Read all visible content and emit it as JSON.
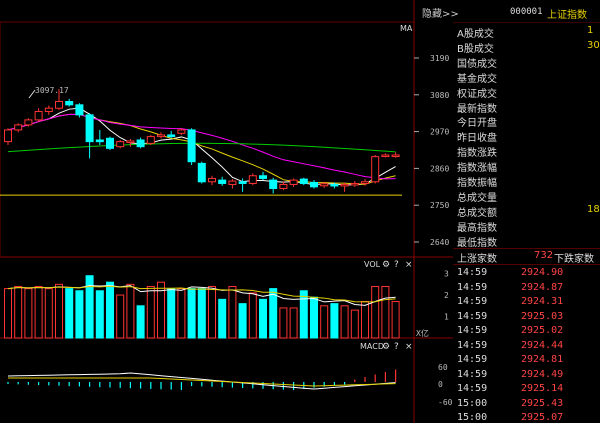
{
  "main": {
    "ma_label": "MA",
    "high_annotation": "3097.17",
    "yaxis": [
      "3190",
      "3080",
      "2970",
      "2860",
      "2750",
      "2640"
    ],
    "candles": [
      {
        "o": 2940,
        "c": 2975,
        "h": 2980,
        "l": 2930,
        "up": true
      },
      {
        "o": 2975,
        "c": 2990,
        "h": 2995,
        "l": 2968,
        "up": true
      },
      {
        "o": 2990,
        "c": 3005,
        "h": 3010,
        "l": 2985,
        "up": true
      },
      {
        "o": 3005,
        "c": 3030,
        "h": 3040,
        "l": 3000,
        "up": true
      },
      {
        "o": 3030,
        "c": 3040,
        "h": 3048,
        "l": 3020,
        "up": true
      },
      {
        "o": 3040,
        "c": 3060,
        "h": 3097,
        "l": 3035,
        "up": true
      },
      {
        "o": 3060,
        "c": 3050,
        "h": 3068,
        "l": 3045,
        "up": false
      },
      {
        "o": 3050,
        "c": 3020,
        "h": 3055,
        "l": 3012,
        "up": false
      },
      {
        "o": 3020,
        "c": 2940,
        "h": 3025,
        "l": 2890,
        "up": false
      },
      {
        "o": 2945,
        "c": 2940,
        "h": 2975,
        "l": 2930,
        "up": false
      },
      {
        "o": 2950,
        "c": 2920,
        "h": 2955,
        "l": 2915,
        "up": false
      },
      {
        "o": 2925,
        "c": 2940,
        "h": 2945,
        "l": 2920,
        "up": true
      },
      {
        "o": 2940,
        "c": 2942,
        "h": 2948,
        "l": 2925,
        "up": true
      },
      {
        "o": 2945,
        "c": 2925,
        "h": 2952,
        "l": 2920,
        "up": false
      },
      {
        "o": 2935,
        "c": 2955,
        "h": 2960,
        "l": 2930,
        "up": true
      },
      {
        "o": 2955,
        "c": 2960,
        "h": 2968,
        "l": 2950,
        "up": true
      },
      {
        "o": 2960,
        "c": 2955,
        "h": 2972,
        "l": 2950,
        "up": false
      },
      {
        "o": 2965,
        "c": 2975,
        "h": 2980,
        "l": 2960,
        "up": true
      },
      {
        "o": 2975,
        "c": 2880,
        "h": 2980,
        "l": 2870,
        "up": false
      },
      {
        "o": 2875,
        "c": 2820,
        "h": 2880,
        "l": 2815,
        "up": false
      },
      {
        "o": 2820,
        "c": 2830,
        "h": 2838,
        "l": 2810,
        "up": true
      },
      {
        "o": 2825,
        "c": 2815,
        "h": 2835,
        "l": 2808,
        "up": false
      },
      {
        "o": 2812,
        "c": 2822,
        "h": 2828,
        "l": 2800,
        "up": true
      },
      {
        "o": 2820,
        "c": 2815,
        "h": 2830,
        "l": 2790,
        "up": false
      },
      {
        "o": 2815,
        "c": 2838,
        "h": 2845,
        "l": 2810,
        "up": true
      },
      {
        "o": 2838,
        "c": 2830,
        "h": 2850,
        "l": 2825,
        "up": false
      },
      {
        "o": 2825,
        "c": 2800,
        "h": 2832,
        "l": 2785,
        "up": false
      },
      {
        "o": 2800,
        "c": 2812,
        "h": 2820,
        "l": 2795,
        "up": true
      },
      {
        "o": 2812,
        "c": 2825,
        "h": 2830,
        "l": 2805,
        "up": true
      },
      {
        "o": 2828,
        "c": 2815,
        "h": 2832,
        "l": 2810,
        "up": false
      },
      {
        "o": 2818,
        "c": 2805,
        "h": 2825,
        "l": 2800,
        "up": false
      },
      {
        "o": 2808,
        "c": 2814,
        "h": 2820,
        "l": 2802,
        "up": true
      },
      {
        "o": 2812,
        "c": 2808,
        "h": 2818,
        "l": 2800,
        "up": false
      },
      {
        "o": 2808,
        "c": 2812,
        "h": 2818,
        "l": 2790,
        "up": true
      },
      {
        "o": 2812,
        "c": 2815,
        "h": 2822,
        "l": 2805,
        "up": true
      },
      {
        "o": 2815,
        "c": 2820,
        "h": 2828,
        "l": 2808,
        "up": true
      },
      {
        "o": 2820,
        "c": 2895,
        "h": 2900,
        "l": 2815,
        "up": true
      },
      {
        "o": 2898,
        "c": 2900,
        "h": 2905,
        "l": 2893,
        "up": true
      },
      {
        "o": 2900,
        "c": 2897,
        "h": 2908,
        "l": 2892,
        "up": true
      }
    ]
  },
  "vol_panel": {
    "title": "VOL",
    "yaxis": [
      "3",
      "2",
      "1"
    ],
    "unit": "X亿",
    "bars": [
      2.3,
      2.4,
      2.3,
      2.4,
      2.3,
      2.5,
      2.3,
      2.2,
      2.9,
      2.2,
      2.6,
      2.0,
      2.5,
      1.5,
      2.4,
      2.6,
      2.3,
      2.3,
      2.3,
      2.3,
      2.4,
      1.8,
      2.4,
      1.6,
      2.1,
      1.8,
      2.3,
      1.4,
      1.4,
      2.2,
      1.9,
      1.5,
      1.6,
      1.5,
      1.3,
      1.7,
      2.4,
      2.4,
      1.7
    ]
  },
  "macd_panel": {
    "title": "MACD",
    "yaxis": [
      "60",
      "0",
      "-60"
    ]
  },
  "header": {
    "hide_label": "隐藏>>",
    "code": "000001",
    "name": "上证指数"
  },
  "info_rows": [
    {
      "label": "A股成交",
      "value": "1"
    },
    {
      "label": "B股成交",
      "value": "30"
    },
    {
      "label": "国债成交",
      "value": ""
    },
    {
      "label": "基金成交",
      "value": ""
    },
    {
      "label": "权证成交",
      "value": ""
    },
    {
      "label": "最新指数",
      "value": ""
    },
    {
      "label": "今日开盘",
      "value": ""
    },
    {
      "label": "昨日收盘",
      "value": ""
    },
    {
      "label": "指数涨跌",
      "value": ""
    },
    {
      "label": "指数涨幅",
      "value": ""
    },
    {
      "label": "指数振幅",
      "value": ""
    },
    {
      "label": "总成交量",
      "value": ""
    },
    {
      "label": "总成交额",
      "value": "18"
    },
    {
      "label": "最高指数",
      "value": ""
    },
    {
      "label": "最低指数",
      "value": ""
    }
  ],
  "updown": {
    "up_label": "上涨家数",
    "up_count": "732",
    "down_label": "下跌家数"
  },
  "ticks": [
    {
      "time": "14:59",
      "price": "2924.90"
    },
    {
      "time": "14:59",
      "price": "2924.87"
    },
    {
      "time": "14:59",
      "price": "2924.31"
    },
    {
      "time": "14:59",
      "price": "2925.03"
    },
    {
      "time": "14:59",
      "price": "2925.02"
    },
    {
      "time": "14:59",
      "price": "2924.44"
    },
    {
      "time": "14:59",
      "price": "2924.81"
    },
    {
      "time": "14:59",
      "price": "2924.49"
    },
    {
      "time": "14:59",
      "price": "2925.14"
    },
    {
      "time": "15:00",
      "price": "2925.43"
    },
    {
      "time": "15:00",
      "price": "2925.07"
    }
  ],
  "colors": {
    "up": "#ff3333",
    "down": "#00ffff",
    "ma5": "#ffffff",
    "ma10": "#e6d200",
    "ma20": "#ff00ff",
    "ma60": "#00cc00",
    "grid": "#550000"
  }
}
